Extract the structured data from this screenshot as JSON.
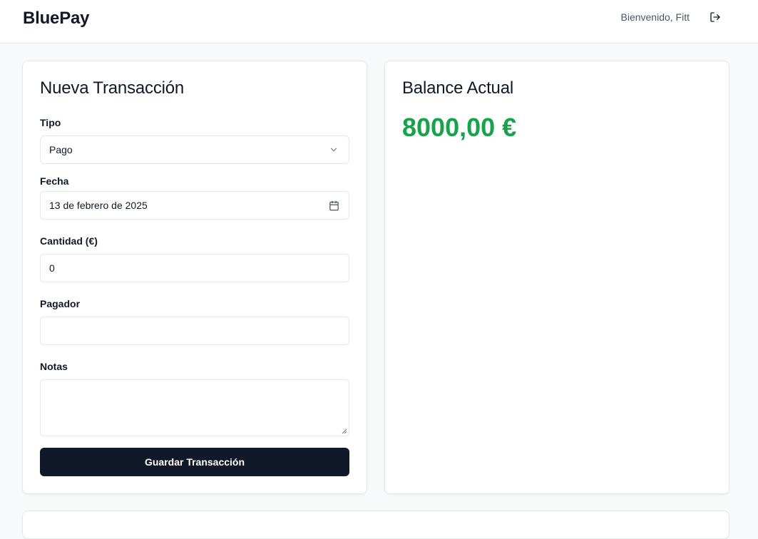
{
  "header": {
    "brand": "BluePay",
    "welcome": "Bienvenido, Fitt",
    "logout_icon": "logout-icon"
  },
  "form": {
    "title": "Nueva Transacción",
    "tipo": {
      "label": "Tipo",
      "value": "Pago",
      "icon": "chevron-down-icon"
    },
    "fecha": {
      "label": "Fecha",
      "value": "13 de febrero de 2025",
      "icon": "calendar-icon"
    },
    "cantidad": {
      "label": "Cantidad (€)",
      "value": "0"
    },
    "pagador": {
      "label": "Pagador",
      "value": ""
    },
    "notas": {
      "label": "Notas",
      "value": ""
    },
    "submit_label": "Guardar Transacción"
  },
  "balance": {
    "title": "Balance Actual",
    "amount": "8000,00 €",
    "amount_color": "#16a34a"
  },
  "colors": {
    "primary_button": "#111827",
    "background": "#f8f9fb",
    "border": "#e5e7eb"
  }
}
